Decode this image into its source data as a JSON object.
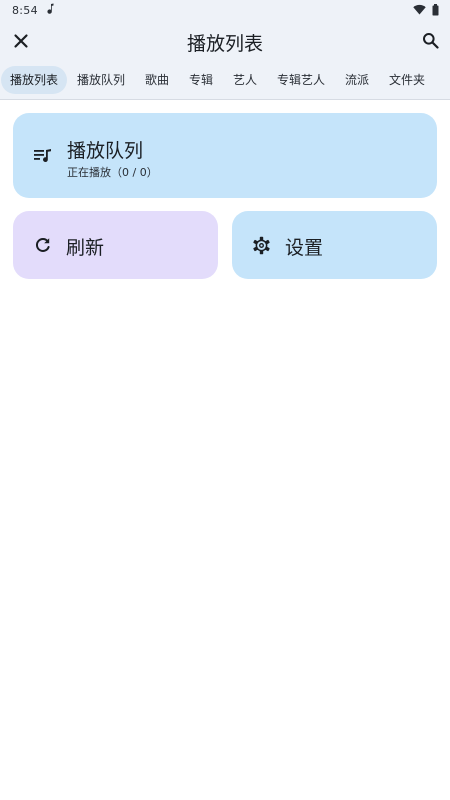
{
  "status_bar": {
    "time": "8:54",
    "note_icon": "music-note-icon",
    "wifi_icon": "wifi-icon",
    "battery_icon": "battery-icon"
  },
  "app_bar": {
    "title": "播放列表",
    "close_icon": "close-icon",
    "search_icon": "search-icon"
  },
  "tabs": [
    {
      "label": "播放列表",
      "active": true
    },
    {
      "label": "播放队列",
      "active": false
    },
    {
      "label": "歌曲",
      "active": false
    },
    {
      "label": "专辑",
      "active": false
    },
    {
      "label": "艺人",
      "active": false
    },
    {
      "label": "专辑艺人",
      "active": false
    },
    {
      "label": "流派",
      "active": false
    },
    {
      "label": "文件夹",
      "active": false
    }
  ],
  "cards": {
    "queue": {
      "title": "播放队列",
      "subtitle": "正在播放（0 / 0）",
      "icon": "queue-music-icon"
    },
    "refresh": {
      "label": "刷新",
      "icon": "refresh-icon"
    },
    "settings": {
      "label": "设置",
      "icon": "settings-icon"
    }
  },
  "colors": {
    "top_bar_bg": "#eef2f8",
    "active_tab_bg": "#d6e5f3",
    "card_blue": "#c5e4fa",
    "card_purple": "#e3dcfb"
  }
}
